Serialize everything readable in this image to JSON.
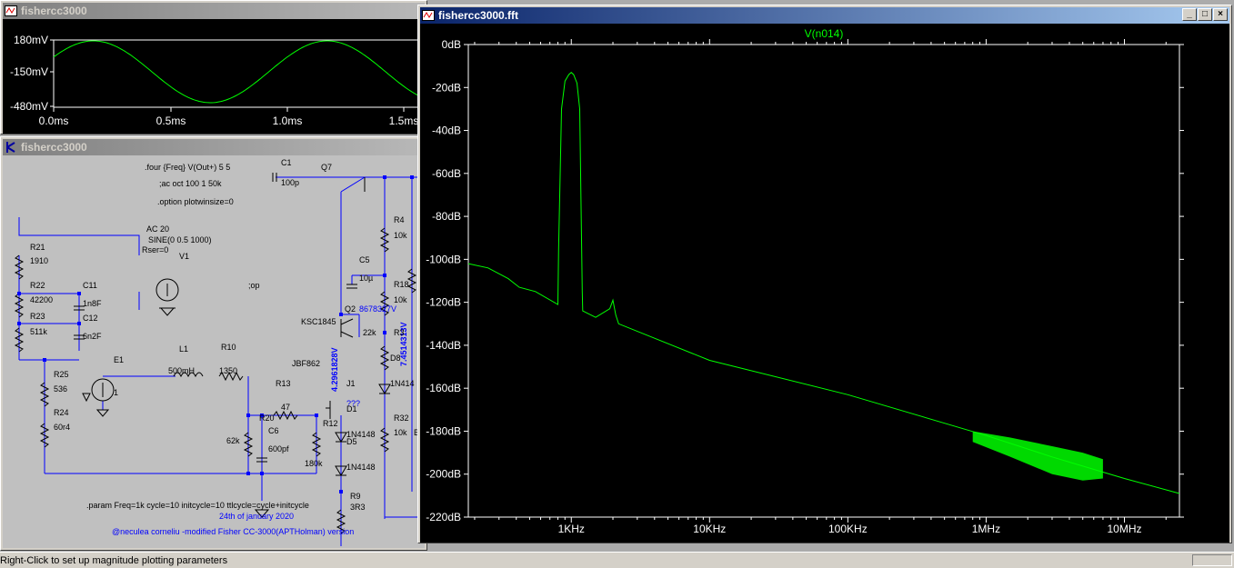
{
  "small_waveform_window": {
    "title": "fishercc3000",
    "y_ticks": [
      "180mV",
      "-150mV",
      "-480mV"
    ],
    "x_ticks": [
      "0.0ms",
      "0.5ms",
      "1.0ms",
      "1.5ms"
    ]
  },
  "schematic_window": {
    "title": "fishercc3000",
    "directives": {
      "four": ".four {Freq} V(Out+) 5 5",
      "ac": ";ac oct 100 1 50k",
      "option": ".option plotwinsize=0",
      "op": ";op",
      "param": ".param Freq=1k cycle=10 initcycle=10 ttlcycle=cycle+initcycle",
      "date": "24th of january 2020",
      "credit": "@neculea corneliu -modified Fisher CC-3000(APTHolman) version"
    },
    "components": {
      "C1": "C1",
      "C1v": "100p",
      "Q7": "Q7",
      "AC": "AC 20",
      "SINE": "SINE(0 0.5 1000)",
      "Rser": "Rser=0",
      "V1": "V1",
      "R21": "R21",
      "R21v": "1910",
      "C11": "C11",
      "C11v": "1n8F",
      "R22": "R22",
      "R22v": "42200",
      "R23": "R23",
      "R23v": "511k",
      "C12": "C12",
      "C12v": "6n2F",
      "E1": "E1",
      "E1v": "1",
      "L1": "L1",
      "L1v": "500mH",
      "R10": "R10",
      "R10v": "1350",
      "R25": "R25",
      "R25v": "536",
      "R24": "R24",
      "R24v": "60r4",
      "R4": "R4",
      "R4v": "10k",
      "C5": "C5",
      "C5v": "10µ",
      "R18": "R18",
      "R18v": "10k",
      "Q2": "Q2",
      "Q2m": "KSC1845",
      "volt1": "4.2961828V",
      "volt2": "8678327V",
      "volt3": "7.4514313V",
      "R22k": "22k",
      "R3": "R3",
      "D8": "D8",
      "D8v": "1N414",
      "J1m": "JBF862",
      "J1": "J1",
      "R13": "R13",
      "R13v": "47",
      "q3": "???",
      "D1": "D1",
      "D1v": "1N4148",
      "R20": "R20",
      "R20v": "62k",
      "C6": "C6",
      "C6v": "600pf",
      "R12": "R12",
      "R12v": "180k",
      "D5": "D5",
      "D5v": "1N4148",
      "R32": "R32",
      "R32v": "10k",
      "B": "B",
      "R9": "R9",
      "R9v": "3R3"
    }
  },
  "fft_window": {
    "title": "fishercc3000.fft",
    "trace_label": "V(n014)",
    "buttons": {
      "minimize": "_",
      "restore": "□",
      "close": "×"
    }
  },
  "chart_data": {
    "type": "line",
    "title": "V(n014)",
    "xlabel": "",
    "ylabel": "",
    "x_scale": "log",
    "xlim": [
      180,
      25000000
    ],
    "ylim": [
      -220,
      0
    ],
    "x_ticks": [
      {
        "label": "1KHz",
        "value": 1000
      },
      {
        "label": "10KHz",
        "value": 10000
      },
      {
        "label": "100KHz",
        "value": 100000
      },
      {
        "label": "1MHz",
        "value": 1000000
      },
      {
        "label": "10MHz",
        "value": 10000000
      }
    ],
    "y_ticks": [
      {
        "label": "0dB",
        "value": 0
      },
      {
        "label": "-20dB",
        "value": -20
      },
      {
        "label": "-40dB",
        "value": -40
      },
      {
        "label": "-60dB",
        "value": -60
      },
      {
        "label": "-80dB",
        "value": -80
      },
      {
        "label": "-100dB",
        "value": -100
      },
      {
        "label": "-120dB",
        "value": -120
      },
      {
        "label": "-140dB",
        "value": -140
      },
      {
        "label": "-160dB",
        "value": -160
      },
      {
        "label": "-180dB",
        "value": -180
      },
      {
        "label": "-200dB",
        "value": -200
      },
      {
        "label": "-220dB",
        "value": -220
      }
    ],
    "grid": false,
    "trace_color": "#00ff00",
    "series": [
      {
        "name": "V(n014)",
        "x": [
          180,
          250,
          350,
          420,
          550,
          800,
          810,
          850,
          900,
          960,
          1000,
          1040,
          1100,
          1150,
          1200,
          1210,
          1500,
          1900,
          2000,
          2100,
          2200,
          10000,
          100000,
          1000000,
          3000000,
          10000000,
          25000000
        ],
        "y": [
          -102,
          -104,
          -109,
          -113,
          -115,
          -121,
          -95,
          -30,
          -17,
          -14,
          -13,
          -14,
          -18,
          -30,
          -115,
          -124,
          -127,
          -123,
          -119,
          -126,
          -130,
          -147,
          -163,
          -182,
          -192,
          -202,
          -209
        ]
      }
    ]
  },
  "status_bar": {
    "text": "Right-Click to set up magnitude plotting parameters"
  }
}
